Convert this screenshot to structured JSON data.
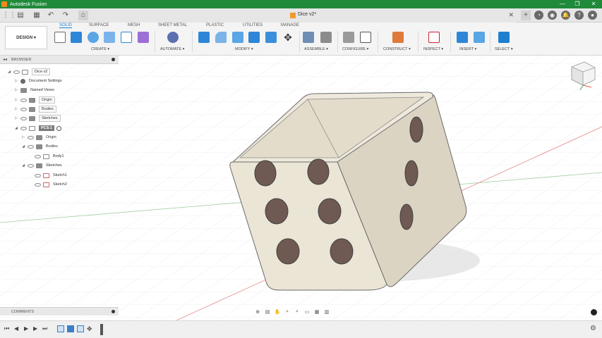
{
  "window": {
    "app_title": "Autodesk Fusion",
    "doc_title": "Dice v2*"
  },
  "workspace": {
    "label": "DESIGN ▾"
  },
  "ws_tabs": [
    "SOLID",
    "SURFACE",
    "MESH",
    "SHEET METAL",
    "PLASTIC",
    "UTILITIES",
    "MANAGE"
  ],
  "tool_groups": [
    "CREATE ▾",
    "AUTOMATE ▾",
    "MODIFY ▾",
    "ASSEMBLE ▾",
    "CONFIGURE ▾",
    "CONSTRUCT ▾",
    "INSPECT ▾",
    "INSERT ▾",
    "SELECT ▾"
  ],
  "browser": {
    "title": "BROWSER",
    "items": [
      {
        "label": "Dice v2"
      },
      {
        "label": "Document Settings"
      },
      {
        "label": "Named Views"
      },
      {
        "label": "Origin"
      },
      {
        "label": "Bodies"
      },
      {
        "label": "Sketches"
      },
      {
        "label": "PCS:1"
      },
      {
        "label": "Origin"
      },
      {
        "label": "Bodies"
      },
      {
        "label": "Body1"
      },
      {
        "label": "Sketches"
      },
      {
        "label": "Sketch1"
      },
      {
        "label": "Sketch2"
      }
    ]
  },
  "comments": {
    "title": "COMMENTS"
  },
  "colors": {
    "title_bar": "#1f8a3a",
    "accent": "#1e7fd0",
    "body": "#ece6d6",
    "pip": "#6e5a52"
  }
}
